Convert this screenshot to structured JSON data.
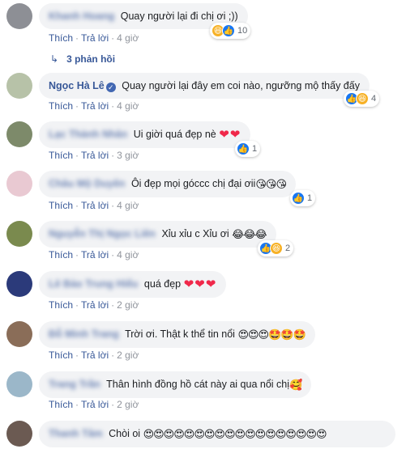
{
  "comments": [
    {
      "author": "Khanh Hoang",
      "author_blurred": true,
      "text": "Quay người lại đi chị ơi ;))",
      "emoji": "",
      "time": "4 giờ",
      "reaction_count": "10",
      "reactions": [
        "haha",
        "like"
      ],
      "avatar_color": "#8d8f95"
    },
    {
      "author": "Ngọc Hà Lê",
      "author_blurred": false,
      "verified": true,
      "text": "Quay người lại đây em coi nào, ngưỡng mộ thấy đấy",
      "emoji": "",
      "time": "4 giờ",
      "reaction_count": "4",
      "reactions": [
        "like",
        "haha"
      ],
      "avatar_color": "#b7c2a8"
    },
    {
      "author": "Lạc Thành Nhân",
      "author_blurred": true,
      "text": "Ui giời quá đẹp nè",
      "emoji": "❤❤",
      "time": "3 giờ",
      "reaction_count": "1",
      "reactions": [
        "like"
      ],
      "avatar_color": "#7d8a6a"
    },
    {
      "author": "Châu Mộ Duyên",
      "author_blurred": true,
      "text": "Ôi đẹp mọi góccc chị đại ơii",
      "emoji": "😘😘😘",
      "time": "4 giờ",
      "reaction_count": "1",
      "reactions": [
        "like"
      ],
      "avatar_color": "#e9c9d2"
    },
    {
      "author": "Nguyễn Thị Ngọc Liên",
      "author_blurred": true,
      "text": "Xỉu xỉu c Xỉu ơi",
      "emoji": "😂😂😂",
      "time": "4 giờ",
      "reaction_count": "2",
      "reactions": [
        "like",
        "haha"
      ],
      "avatar_color": "#7a8a4e"
    },
    {
      "author": "Lê Bảo Trung Hiếu",
      "author_blurred": true,
      "text": "quá đẹp",
      "emoji": "❤❤❤",
      "time": "2 giờ",
      "reaction_count": "",
      "reactions": [],
      "avatar_color": "#2b3a7a"
    },
    {
      "author": "Đỗ Minh Trang",
      "author_blurred": true,
      "text": "Trời ơi. Thật k thể tin nổi",
      "emoji": "😍😍😍🤩🤩🤩",
      "time": "2 giờ",
      "reaction_count": "",
      "reactions": [],
      "avatar_color": "#8a6d58"
    },
    {
      "author": "Trang Trần",
      "author_blurred": true,
      "text": "Thân hình đồng hồ cát này ai qua nổi chị",
      "emoji": "🥰",
      "time": "2 giờ",
      "reaction_count": "",
      "reactions": [],
      "avatar_color": "#9bb7c9"
    },
    {
      "author": "Thanh Tâm",
      "author_blurred": true,
      "text": "Chòi oi",
      "emoji": "😍😍😍😍😍😍😍😍😍😍😍😍😍😍😍😍😍😍",
      "time": "",
      "reaction_count": "",
      "reactions": [],
      "avatar_color": "#6b5a52"
    }
  ],
  "labels": {
    "like": "Thích",
    "reply": "Trả lời",
    "view_replies": "3 phản hồi"
  }
}
